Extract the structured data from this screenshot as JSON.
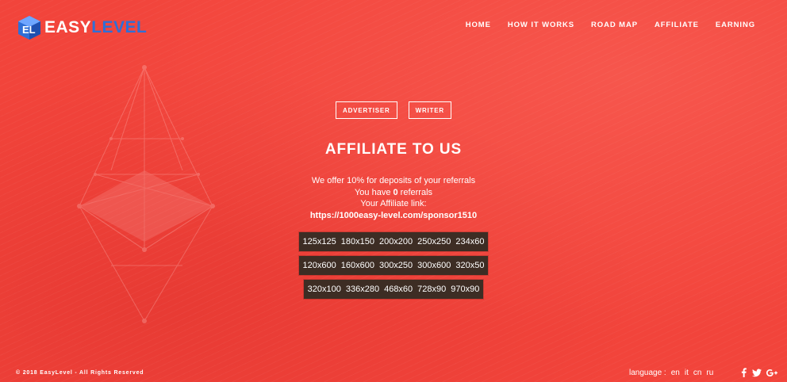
{
  "brand": {
    "part1": "EASY",
    "part2": "LEVEL",
    "mark": "EL"
  },
  "nav": [
    {
      "label": "HOME"
    },
    {
      "label": "HOW IT WORKS"
    },
    {
      "label": "ROAD MAP"
    },
    {
      "label": "AFFILIATE"
    },
    {
      "label": "EARNING"
    }
  ],
  "tabs": {
    "advertiser": "ADVERTISER",
    "writer": "WRITER"
  },
  "title": "AFFILIATE TO US",
  "info": {
    "line1": "We offer 10% for deposits of your referrals",
    "referrals_prefix": "You have ",
    "referrals_count": "0",
    "referrals_suffix": " referrals",
    "link_label": "Your Affiliate link:",
    "link_url": "https://1000easy-level.com/sponsor1510"
  },
  "banner_sizes": [
    [
      "125x125",
      "180x150",
      "200x200",
      "250x250",
      "234x60"
    ],
    [
      "120x600",
      "160x600",
      "300x250",
      "300x600",
      "320x50"
    ],
    [
      "320x100",
      "336x280",
      "468x60",
      "728x90",
      "970x90"
    ]
  ],
  "footer": {
    "copyright": "© 2018 EasyLevel - All Rights Reserved",
    "language_label": "language :",
    "languages": [
      "en",
      "it",
      "cn",
      "ru"
    ]
  },
  "social_icons": [
    "facebook-icon",
    "twitter-icon",
    "google-plus-icon"
  ],
  "colors": {
    "background": "#f2443b",
    "brand_blue": "#2f6fd6",
    "banner_bg": "#3d2d24"
  }
}
